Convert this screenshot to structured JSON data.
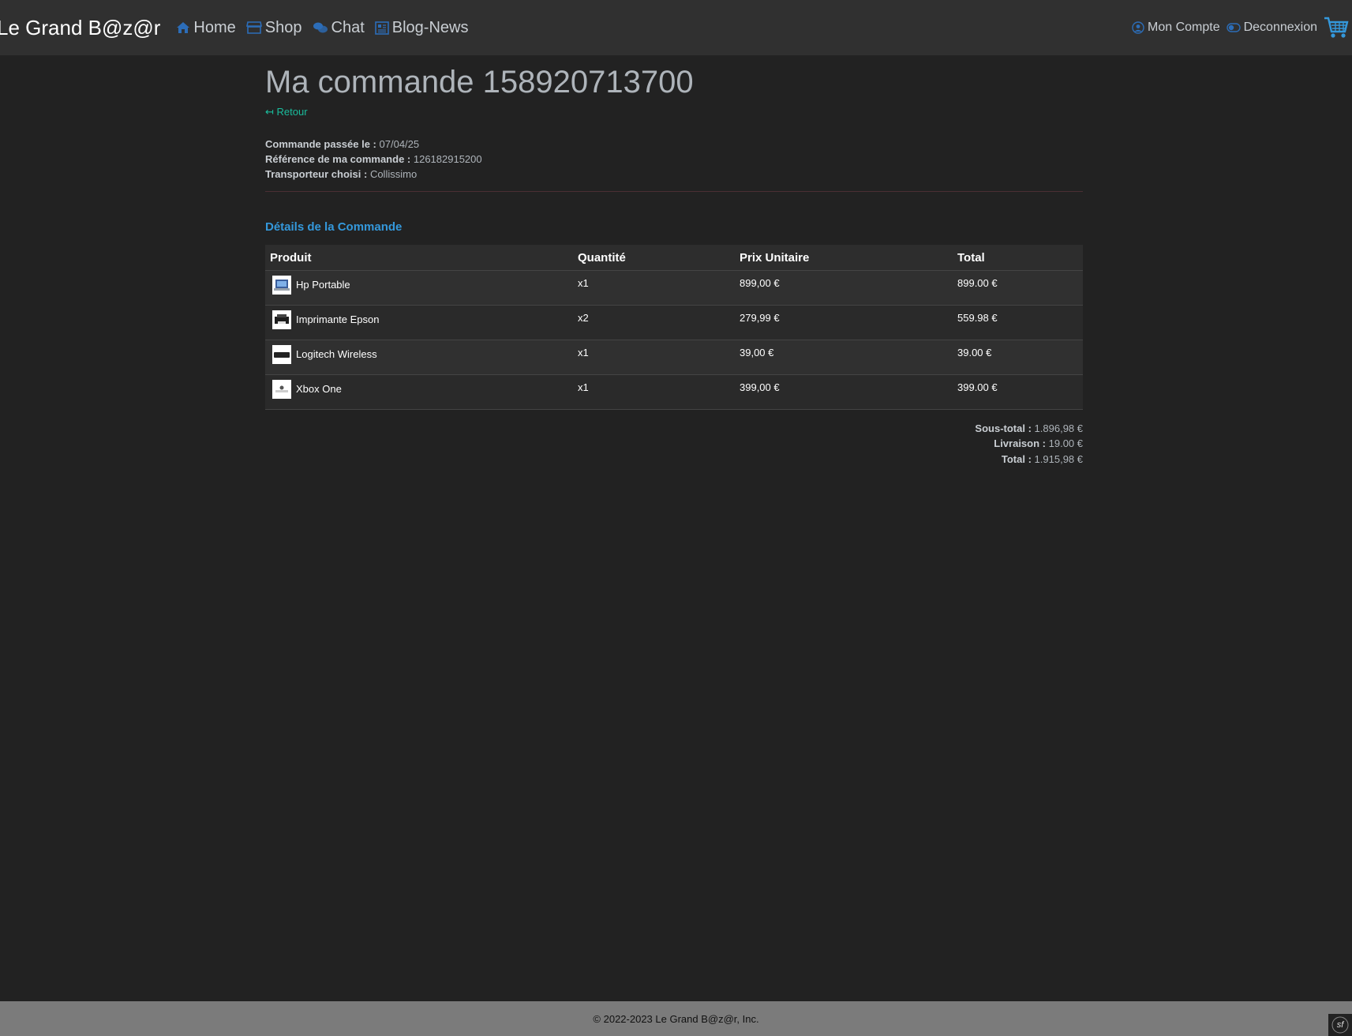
{
  "navbar": {
    "brand": "Le Grand B@z@r",
    "links": [
      {
        "label": "Home",
        "icon": "home-icon"
      },
      {
        "label": "Shop",
        "icon": "shop-icon"
      },
      {
        "label": "Chat",
        "icon": "chat-icon"
      },
      {
        "label": "Blog-News",
        "icon": "newspaper-icon"
      }
    ],
    "account_label": "Mon Compte",
    "logout_label": "Deconnexion",
    "cart_icon": "cart-icon"
  },
  "order": {
    "title": "Ma commande 158920713700",
    "back_label": "Retour",
    "placed_label": "Commande passée le :",
    "placed_value": "07/04/25",
    "reference_label": "Référence de ma commande :",
    "reference_value": "126182915200",
    "carrier_label": "Transporteur choisi :",
    "carrier_value": "Collissimo"
  },
  "details": {
    "title": "Détails de la Commande",
    "columns": [
      "Produit",
      "Quantité",
      "Prix Unitaire",
      "Total"
    ],
    "rows": [
      {
        "product": "Hp Portable",
        "qty": "x1",
        "unit": "899,00 €",
        "total": "899.00 €"
      },
      {
        "product": "Imprimante Epson",
        "qty": "x2",
        "unit": "279,99 €",
        "total": "559.98 €"
      },
      {
        "product": "Logitech Wireless",
        "qty": "x1",
        "unit": "39,00 €",
        "total": "39.00 €"
      },
      {
        "product": "Xbox One",
        "qty": "x1",
        "unit": "399,00 €",
        "total": "399.00 €"
      }
    ]
  },
  "totals": {
    "subtotal_label": "Sous-total :",
    "subtotal_value": "1.896,98 €",
    "shipping_label": "Livraison :",
    "shipping_value": "19.00 €",
    "total_label": "Total :",
    "total_value": "1.915,98 €"
  },
  "footer": {
    "text": "© 2022-2023 Le Grand B@z@r, Inc.",
    "badge": "sf"
  },
  "colors": {
    "background": "#222222",
    "navbar": "#303030",
    "accent_green": "#1abc9c",
    "accent_blue": "#3498db",
    "footer": "#7b7b7b"
  }
}
